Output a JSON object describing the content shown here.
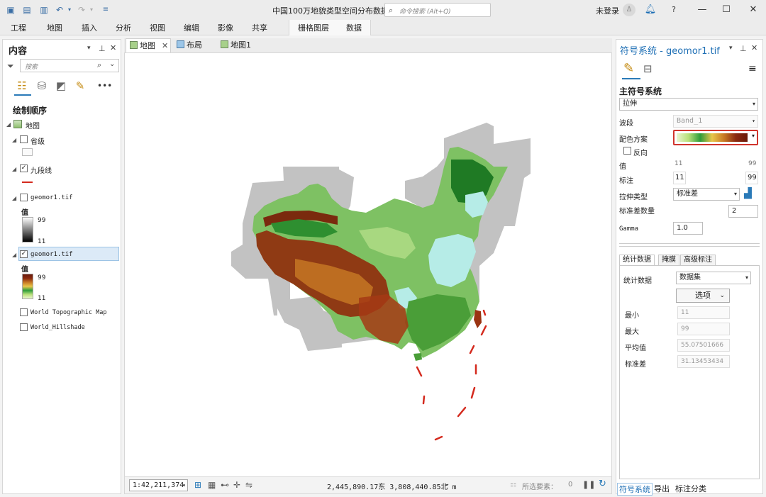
{
  "titlebar": {
    "document_title": "中国100万地貌类型空间分布数据",
    "command_search_placeholder": "命令搜索 (Alt+Q)",
    "sign_in": "未登录"
  },
  "ribbon": {
    "tabs": [
      "工程",
      "地图",
      "插入",
      "分析",
      "视图",
      "编辑",
      "影像",
      "共享"
    ],
    "contextual_tabs": [
      "栅格图层",
      "数据"
    ]
  },
  "contents": {
    "title": "内容",
    "search_placeholder": "搜索",
    "draw_order_label": "绘制顺序",
    "map_name": "地图",
    "layers": {
      "provinces": "省级",
      "nine_dash": "九段线",
      "geomor_a": "geomor1.tif",
      "geomor_b": "geomor1.tif",
      "world_topo": "World Topographic Map",
      "world_hillshade": "World_Hillshade"
    },
    "legend_a": {
      "title": "值",
      "max": "99",
      "min": "11"
    },
    "legend_b": {
      "title": "值",
      "max": "99",
      "min": "11"
    }
  },
  "map_tabs": [
    "地图",
    "布局",
    "地图1"
  ],
  "statusbar": {
    "scale": "1:42,211,374",
    "coordinates": "2,445,890.17东 3,808,440.85北 m",
    "selected_features_label": "所选要素：",
    "selected_count": "0"
  },
  "symbology": {
    "title": "符号系统 - geomor1.tif",
    "primary_label": "主符号系统",
    "renderer": "拉伸",
    "band_label": "波段",
    "band_value": "Band_1",
    "color_scheme_label": "配色方案",
    "invert_label": "反向",
    "value_label": "值",
    "value_min": "11",
    "value_max": "99",
    "label_label": "标注",
    "label_min": "11",
    "label_max": "99",
    "stretch_type_label": "拉伸类型",
    "stretch_type_value": "标准差",
    "stddev_count_label": "标准差数量",
    "stddev_count_value": "2",
    "gamma_label": "Gamma",
    "gamma_value": "1.0",
    "tabs": [
      "统计数据",
      "掩膜",
      "高级标注"
    ],
    "stats_label": "统计数据",
    "stats_source": "数据集",
    "options_button": "选项",
    "min_label": "最小",
    "min_value": "11",
    "max_label": "最大",
    "max_value": "99",
    "mean_label": "平均值",
    "mean_value": "55.07501666",
    "std_label": "标准差",
    "std_value": "31.13453434"
  },
  "bottom_tabs": [
    "符号系统",
    "导出",
    "标注分类"
  ],
  "colors": {
    "accent": "#2a7ab8",
    "ramp_highlight": "#d0342c",
    "nine_dash_line": "#d42a1e",
    "basemap_gray": "#c2c2c2",
    "water_cyan": "#b6ece7"
  }
}
